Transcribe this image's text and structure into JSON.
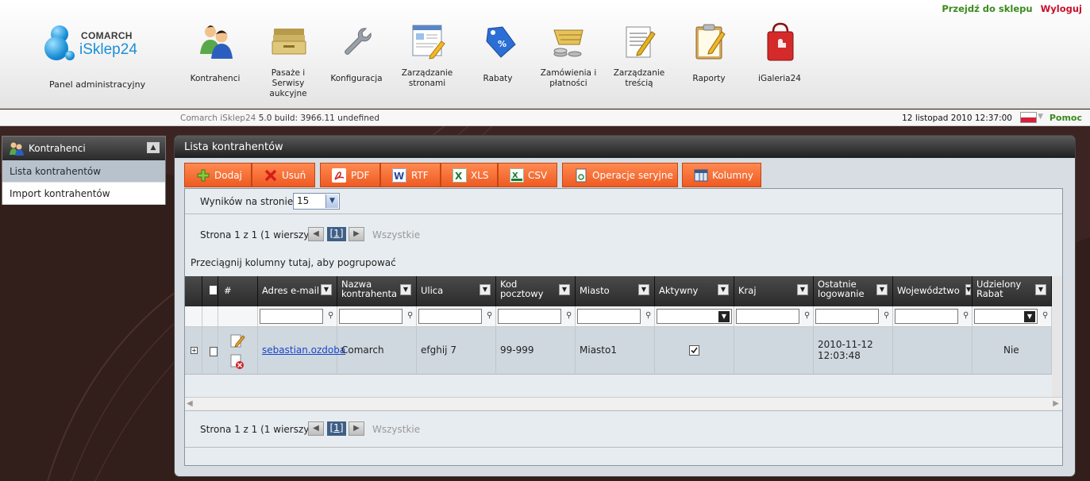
{
  "top_links": {
    "shop": "Przejdź do sklepu",
    "logout": "Wyloguj"
  },
  "brand": {
    "company": "COMARCH",
    "product": "iSklep24",
    "panel": "Panel administracyjny"
  },
  "nav": [
    {
      "label": "Kontrahenci",
      "icon": "people-icon"
    },
    {
      "label": "Pasaże i Serwisy aukcyjne",
      "icon": "folders-icon"
    },
    {
      "label": "Konfiguracja",
      "icon": "wrench-icon"
    },
    {
      "label": "Zarządzanie stronami",
      "icon": "web-page-edit-icon"
    },
    {
      "label": "Rabaty",
      "icon": "discount-tag-icon"
    },
    {
      "label": "Zamówienia i płatności",
      "icon": "cart-coins-icon"
    },
    {
      "label": "Zarządzanie treścią",
      "icon": "document-edit-icon"
    },
    {
      "label": "Raporty",
      "icon": "clipboard-icon"
    },
    {
      "label": "iGaleria24",
      "icon": "shopping-bag-icon"
    }
  ],
  "infobar": {
    "version_name": "Comarch iSklep24",
    "version_build": "5.0 build: 3966.11  undefined",
    "datetime": "12 listopad 2010 12:37:00",
    "help": "Pomoc"
  },
  "sidebar": {
    "title": "Kontrahenci",
    "items": [
      {
        "label": "Lista kontrahentów",
        "active": true
      },
      {
        "label": "Import kontrahentów",
        "active": false
      }
    ]
  },
  "main": {
    "title": "Lista kontrahentów",
    "toolbar": {
      "add": "Dodaj",
      "delete": "Usuń",
      "pdf": "PDF",
      "rtf": "RTF",
      "xls": "XLS",
      "csv": "CSV",
      "batch": "Operacje seryjne",
      "columns": "Kolumny"
    },
    "page_size_label": "Wyników na stronie:",
    "page_size_value": "15",
    "pager": {
      "info": "Strona 1 z 1 (1 wierszy)",
      "current": "[1]",
      "all": "Wszystkie"
    },
    "group_hint": "Przeciągnij kolumny tutaj, aby pogrupować",
    "grid": {
      "number_col": "#",
      "columns": [
        {
          "key": "email",
          "label": "Adres e-mail"
        },
        {
          "key": "name",
          "label": "Nazwa kontrahenta"
        },
        {
          "key": "street",
          "label": "Ulica"
        },
        {
          "key": "zip",
          "label": "Kod pocztowy"
        },
        {
          "key": "city",
          "label": "Miasto"
        },
        {
          "key": "active",
          "label": "Aktywny"
        },
        {
          "key": "country",
          "label": "Kraj"
        },
        {
          "key": "last_login",
          "label": "Ostatnie logowanie"
        },
        {
          "key": "region",
          "label": "Województwo"
        },
        {
          "key": "discount",
          "label": "Udzielony Rabat"
        }
      ],
      "rows": [
        {
          "email": "sebastian.ozdoba",
          "name": "Comarch",
          "street": "efghij 7",
          "zip": "99-999",
          "city": "Miasto1",
          "active": true,
          "country": "",
          "last_login": "2010-11-12 12:03:48",
          "region": "",
          "discount": "Nie"
        }
      ]
    }
  }
}
